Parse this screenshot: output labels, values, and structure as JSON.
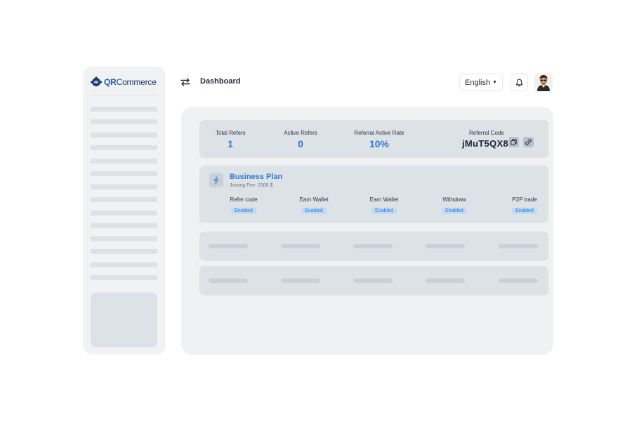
{
  "brand": {
    "bold": "QR",
    "rest": "Commerce"
  },
  "header": {
    "title": "Dashboard",
    "language": "English"
  },
  "stats": {
    "total_refers": {
      "label": "Total Refers",
      "value": "1"
    },
    "active_refers": {
      "label": "Active Refers",
      "value": "0"
    },
    "active_rate": {
      "label": "Referral Active Rate",
      "value": "10%"
    },
    "referral_code": {
      "label": "Referral Code",
      "value": "jMuT5QX8"
    }
  },
  "plan": {
    "title": "Business Plan",
    "fee": "Joining Fee: 2000 $",
    "features": [
      {
        "label": "Refer code",
        "status": "Enabled"
      },
      {
        "label": "Earn Wallet",
        "status": "Enabled"
      },
      {
        "label": "Earn Wallet",
        "status": "Enabled"
      },
      {
        "label": "Withdraw",
        "status": "Enabled"
      },
      {
        "label": "P2P trade",
        "status": "Enabled"
      }
    ]
  },
  "colors": {
    "accent": "#2e7bd1",
    "brand": "#1e5fb3",
    "badge_bg": "#bfdbf5"
  },
  "icons": [
    "menu-switch-icon",
    "bell-icon",
    "copy-icon",
    "link-icon",
    "lightning-icon",
    "logo-icon",
    "chevron-down-icon"
  ]
}
